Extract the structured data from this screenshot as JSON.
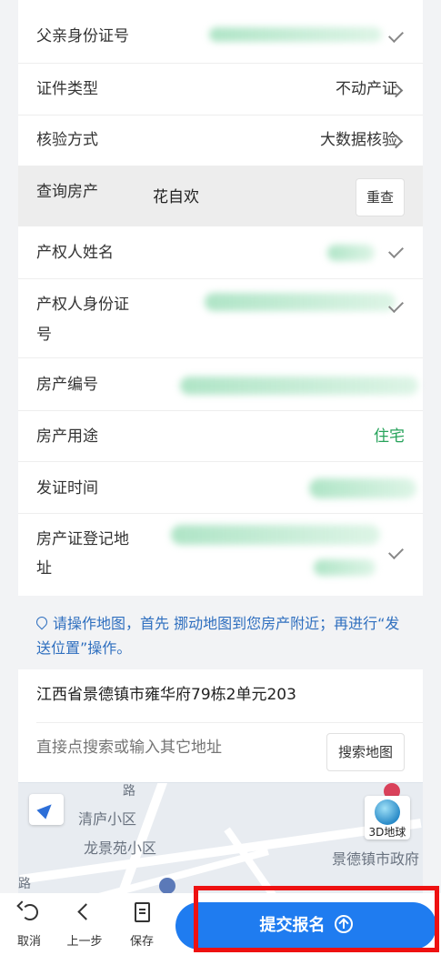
{
  "form": {
    "father_id": {
      "label": "父亲身份证号"
    },
    "cert_type": {
      "label": "证件类型",
      "value": "不动产证"
    },
    "verify_method": {
      "label": "核验方式",
      "value": "大数据核验"
    },
    "query_property": {
      "label": "查询房产",
      "value": "花自欢",
      "button": "重查"
    },
    "owner_name": {
      "label": "产权人姓名"
    },
    "owner_id": {
      "label_line1": "产权人身份证",
      "label_line2": "号"
    },
    "property_no": {
      "label": "房产编号"
    },
    "property_use": {
      "label": "房产用途",
      "value": "住宅"
    },
    "issue_date": {
      "label": "发证时间"
    },
    "register_addr": {
      "label_line1": "房产证登记地",
      "label_line2": "址"
    }
  },
  "tip": {
    "text": "请操作地图，首先 挪动地图到您房产附近；再进行“发送位置”操作。"
  },
  "address": {
    "current": "江西省景德镇市雍华府79栋2单元203",
    "search_placeholder": "直接点搜索或输入其它地址",
    "search_button": "搜索地图"
  },
  "map": {
    "labels": {
      "qinglu": "清庐小区",
      "longjingyuan": "龙景苑小区",
      "gov": "景德镇市政府",
      "road": "路",
      "road2": "路"
    },
    "globe_button": "3D地球"
  },
  "bottom_bar": {
    "cancel": "取消",
    "prev": "上一步",
    "save": "保存",
    "submit": "提交报名"
  },
  "colors": {
    "accent": "#1f7cf0",
    "green_value": "#27a35b",
    "highlight_box": "#ee1111",
    "tip": "#2f6fbf"
  }
}
